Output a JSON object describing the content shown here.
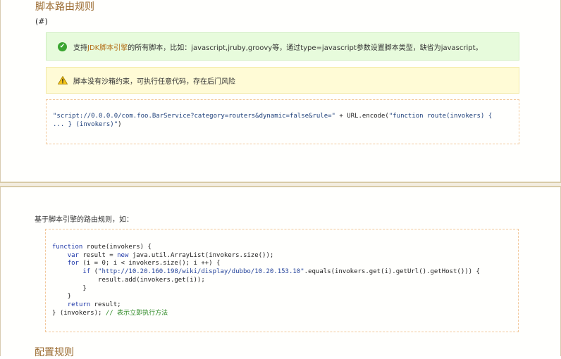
{
  "section": {
    "title": "脚本路由规则",
    "anchor": "(#)"
  },
  "success_message": {
    "icon": "check-circle-icon",
    "prefix": "支持",
    "highlight": "JDK脚本引擎",
    "suffix": "的所有脚本，比如：javascript,jruby,groovy等，通过type=javascript参数设置脚本类型，缺省为javascript。"
  },
  "warning_message": {
    "icon": "warning-triangle-icon",
    "text": "脚本没有沙箱约束，可执行任意代码，存在后门风险"
  },
  "code_example_1": {
    "line1_string": "\"script://0.0.0.0/com.foo.BarService?category=routers&dynamic=false&rule=\"",
    "line1_plain": " + URL.encode(",
    "line1_arg": "\"function route(invokers) {",
    "line2_arg": "... } (invokers)\"",
    "line2_plain": ")"
  },
  "intro_text": "基于脚本引擎的路由规则，如：",
  "code_example_2": {
    "l1_kw": "function",
    "l1_rest": " route(invokers) {",
    "l2_indent": "    ",
    "l2_kw": "var",
    "l2_mid": " result = ",
    "l2_kw2": "new",
    "l2_rest": " java.util.ArrayList(invokers.size());",
    "l3_indent": "    ",
    "l3_kw": "for",
    "l3_rest": " (i = 0; i < invokers.size(); i ++) {",
    "l4_indent": "        ",
    "l4_kw": "if",
    "l4_mid": " (",
    "l4_str": "\"http://10.20.160.198/wiki/display/dubbo/10.20.153.10\"",
    "l4_rest": ".equals(invokers.get(i).getUrl().getHost())) {",
    "l5": "            result.add(invokers.get(i));",
    "l6": "        }",
    "l7": "    }",
    "l8_indent": "    ",
    "l8_kw": "return",
    "l8_rest": " result;",
    "l9_code": "} (invokers); ",
    "l9_comment": "// 表示立即执行方法"
  },
  "next_section": {
    "title": "配置规则"
  },
  "colors": {
    "heading": "#9a6a2f",
    "success_bg": "#e7fbdc",
    "warning_bg": "#fffbd6",
    "code_border": "#f2c89a",
    "keyword": "#1b35a7",
    "comment": "#2f8a26"
  }
}
